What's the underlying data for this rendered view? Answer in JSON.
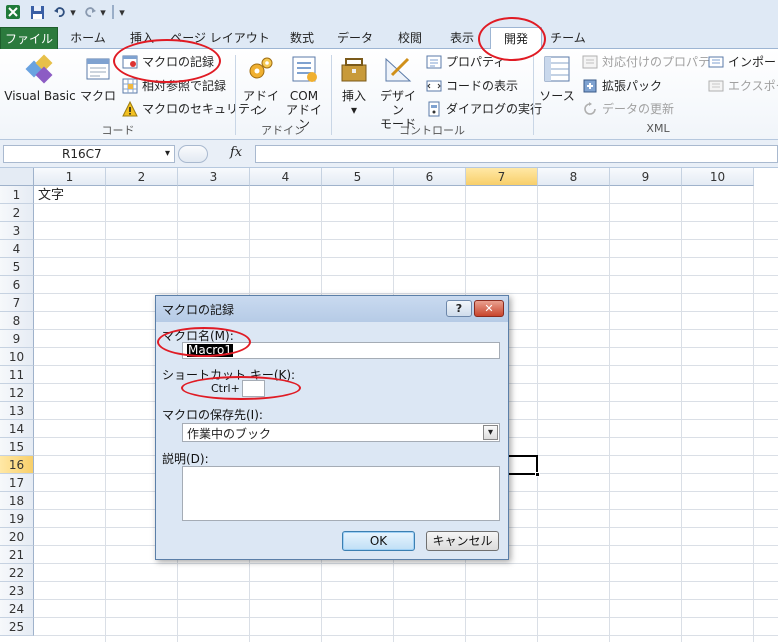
{
  "qat": {
    "undo_arrow": "▾",
    "redo_arrow": "▾",
    "customize": "▾"
  },
  "tabs": [
    {
      "label": "ファイル"
    },
    {
      "label": "ホーム"
    },
    {
      "label": "挿入"
    },
    {
      "label": "ページ レイアウト"
    },
    {
      "label": "数式"
    },
    {
      "label": "データ"
    },
    {
      "label": "校閲"
    },
    {
      "label": "表示"
    },
    {
      "label": "開発"
    },
    {
      "label": "チーム"
    }
  ],
  "ribbon": {
    "code": {
      "group_label": "コード",
      "visual_basic": "Visual Basic",
      "macro": "マクロ",
      "record_macro": "マクロの記録",
      "relative_ref": "相対参照で記録",
      "macro_security": "マクロのセキュリティ"
    },
    "addin": {
      "group_label": "アドイン",
      "addin": "アドイン",
      "com_line1": "COM",
      "com_line2": "アドイン"
    },
    "controls": {
      "group_label": "コントロール",
      "insert": "挿入",
      "insert_arrow": "▾",
      "design_line1": "デザイン",
      "design_line2": "モード",
      "properties": "プロパティ",
      "view_code": "コードの表示",
      "run_dialog": "ダイアログの実行"
    },
    "xml": {
      "group_label": "XML",
      "source": "ソース",
      "map_properties": "対応付けのプロパティ",
      "expansion_packs": "拡張パック",
      "refresh_data": "データの更新",
      "import": "インポート",
      "export": "エクスポート"
    }
  },
  "formula_bar": {
    "name_box": "R16C7",
    "name_arrow": "▾",
    "fx": "fx",
    "value": ""
  },
  "grid": {
    "columns": [
      "1",
      "2",
      "3",
      "4",
      "5",
      "6",
      "7",
      "8",
      "9",
      "10"
    ],
    "rows": [
      "1",
      "2",
      "3",
      "4",
      "5",
      "6",
      "7",
      "8",
      "9",
      "10",
      "11",
      "12",
      "13",
      "14",
      "15",
      "16",
      "17",
      "18",
      "19",
      "20",
      "21",
      "22",
      "23",
      "24",
      "25"
    ],
    "selected_column": "7",
    "selected_row": "16",
    "cell_r1c1": "文字"
  },
  "dialog": {
    "title": "マクロの記録",
    "help_button": "?",
    "close_button": "✕",
    "macro_name_label": "マクロ名(M):",
    "macro_name_value": "Macro1",
    "shortcut_label": "ショートカット キー(K):",
    "ctrl_prefix": "Ctrl+",
    "shortcut_value": "",
    "store_label": "マクロの保存先(I):",
    "store_value": "作業中のブック",
    "store_arrow": "▾",
    "description_label": "説明(D):",
    "description_value": "",
    "ok_button": "OK",
    "cancel_button": "キャンセル"
  }
}
